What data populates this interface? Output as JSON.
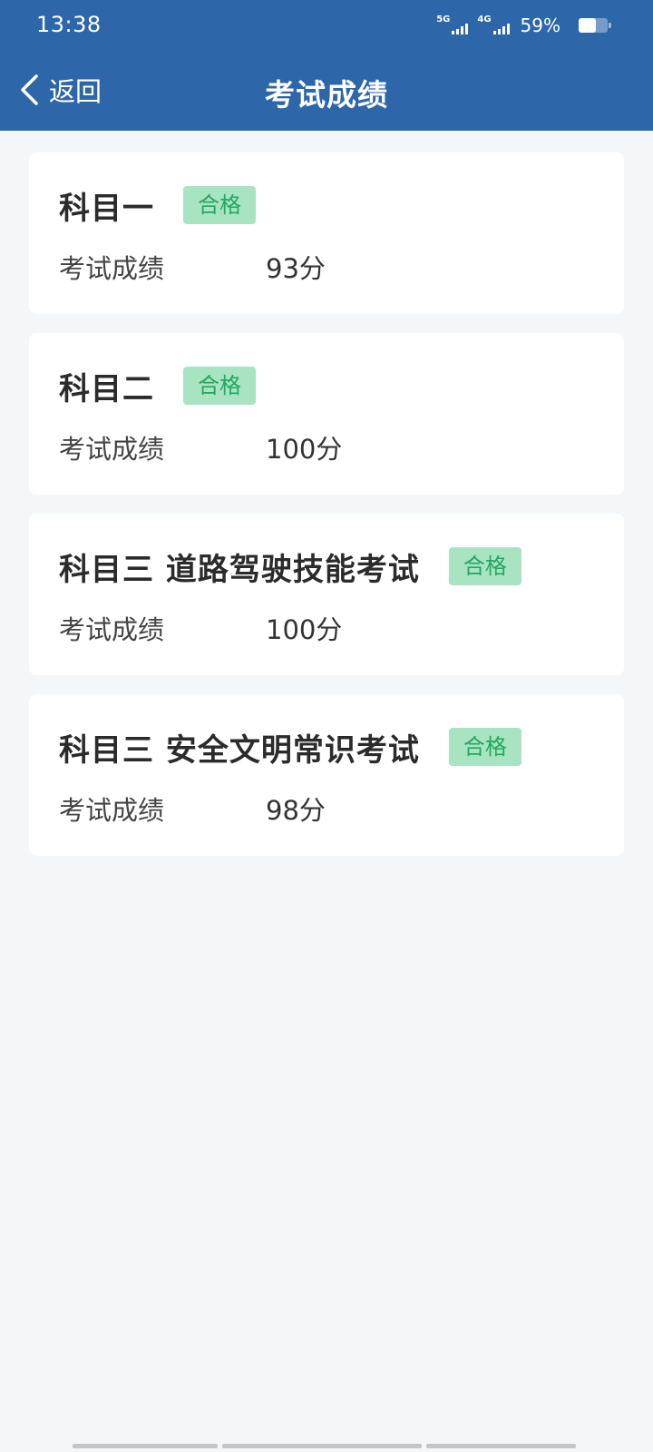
{
  "status_bar": {
    "time": "13:38",
    "signals": [
      {
        "label": "5G",
        "bars": 4
      },
      {
        "label": "4G",
        "bars": 4
      }
    ],
    "battery_percent_text": "59%",
    "battery_level": 0.59
  },
  "nav": {
    "back_label": "返回",
    "title": "考试成绩",
    "back_icon": "chevron-left-icon"
  },
  "score_label": "考试成绩",
  "exams": [
    {
      "title": "科目一",
      "status": "合格",
      "score": "93分"
    },
    {
      "title": "科目二",
      "status": "合格",
      "score": "100分"
    },
    {
      "title": "科目三 道路驾驶技能考试",
      "status": "合格",
      "score": "100分"
    },
    {
      "title": "科目三 安全文明常识考试",
      "status": "合格",
      "score": "98分"
    }
  ],
  "colors": {
    "header_bg": "#2e67a9",
    "page_bg": "#f3f7f9",
    "badge_bg": "#a9e4c2",
    "badge_text": "#23a860"
  }
}
